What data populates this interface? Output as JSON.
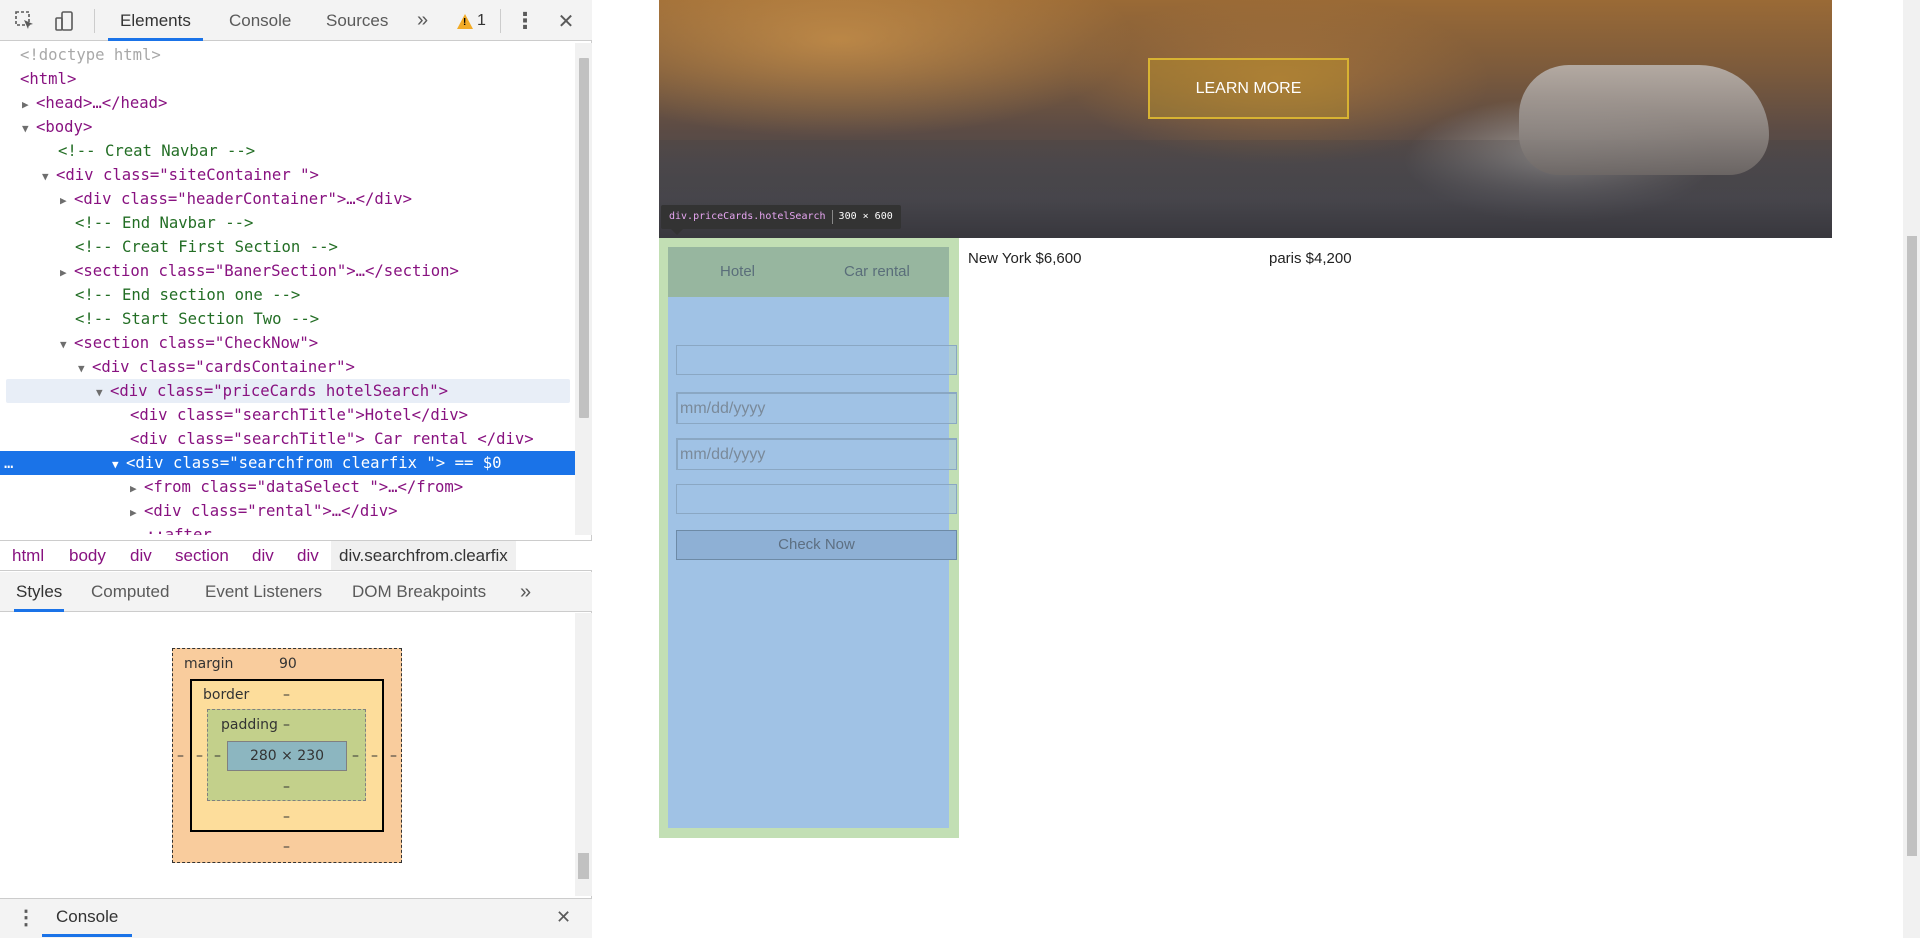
{
  "devtools": {
    "tabs": [
      {
        "label": "Elements"
      },
      {
        "label": "Console"
      },
      {
        "label": "Sources"
      }
    ],
    "more_tabs": "»",
    "warning_count": "1",
    "menu_glyph": "⋮",
    "close_glyph": "✕",
    "dom_lines": [
      {
        "indent": 0,
        "text": "<!doctype html>"
      },
      {
        "indent": 0,
        "text": "<html>"
      },
      {
        "indent": 0,
        "text": "<head>…</head>"
      },
      {
        "indent": 0,
        "text": "<body>"
      },
      {
        "indent": 1,
        "text": "<!-- Creat Navbar -->"
      },
      {
        "indent": 1,
        "text": "<div class=\"siteContainer \">"
      },
      {
        "indent": 2,
        "text": "<div class=\"headerContainer\">…</div>"
      },
      {
        "indent": 2,
        "text": "<!-- End Navbar -->"
      },
      {
        "indent": 2,
        "text": "<!-- Creat First Section -->"
      },
      {
        "indent": 2,
        "text": "<section class=\"BanerSection\">…</section>"
      },
      {
        "indent": 2,
        "text": "<!-- End section one -->"
      },
      {
        "indent": 2,
        "text": "<!-- Start Section Two -->"
      },
      {
        "indent": 2,
        "text": "<section class=\"CheckNow\">"
      },
      {
        "indent": 3,
        "text": "<div class=\"cardsContainer\">"
      },
      {
        "indent": 4,
        "text": "<div class=\"priceCards hotelSearch\">"
      },
      {
        "indent": 5,
        "text": "<div class=\"searchTitle\">Hotel</div>"
      },
      {
        "indent": 5,
        "text": "<div class=\"searchTitle\"> Car rental </div>"
      },
      {
        "indent": 5,
        "text": "<div class=\"searchfrom clearfix \"> == $0"
      },
      {
        "indent": 6,
        "text": "<from class=\"dataSelect \">…</from>"
      },
      {
        "indent": 6,
        "text": "<div class=\"rental\">…</div>"
      },
      {
        "indent": 6,
        "text": "::after"
      }
    ],
    "selected_marker": "== $0",
    "breadcrumbs": [
      "html",
      "body",
      "div",
      "section",
      "div",
      "div",
      "div.searchfrom.clearfix"
    ],
    "sub_tabs": [
      {
        "label": "Styles"
      },
      {
        "label": "Computed"
      },
      {
        "label": "Event Listeners"
      },
      {
        "label": "DOM Breakpoints"
      }
    ],
    "box_model": {
      "margin_label": "margin",
      "margin_top": "90",
      "margin_left": "–",
      "margin_right": "–",
      "margin_bottom": "–",
      "border_label": "border",
      "border_top": "–",
      "border_left": "–",
      "border_right": "–",
      "border_bottom": "–",
      "padding_label": "padding",
      "padding_top": "–",
      "padding_left": "–",
      "padding_right": "–",
      "padding_bottom": "–",
      "content_size": "280 × 230"
    },
    "console_drawer": {
      "label": "Console"
    }
  },
  "page": {
    "learn_more": "LEARN MORE",
    "tooltip": {
      "name": "div.priceCards.hotelSearch",
      "size": "300 × 600"
    },
    "card": {
      "tab_hotel": "Hotel",
      "tab_car": "Car rental",
      "date1_placeholder": "mm/dd/yyyy",
      "date2_placeholder": "mm/dd/yyyy",
      "check_button": "Check Now"
    },
    "prices": [
      {
        "text": "New York $6,600"
      },
      {
        "text": "paris $4,200"
      }
    ]
  }
}
